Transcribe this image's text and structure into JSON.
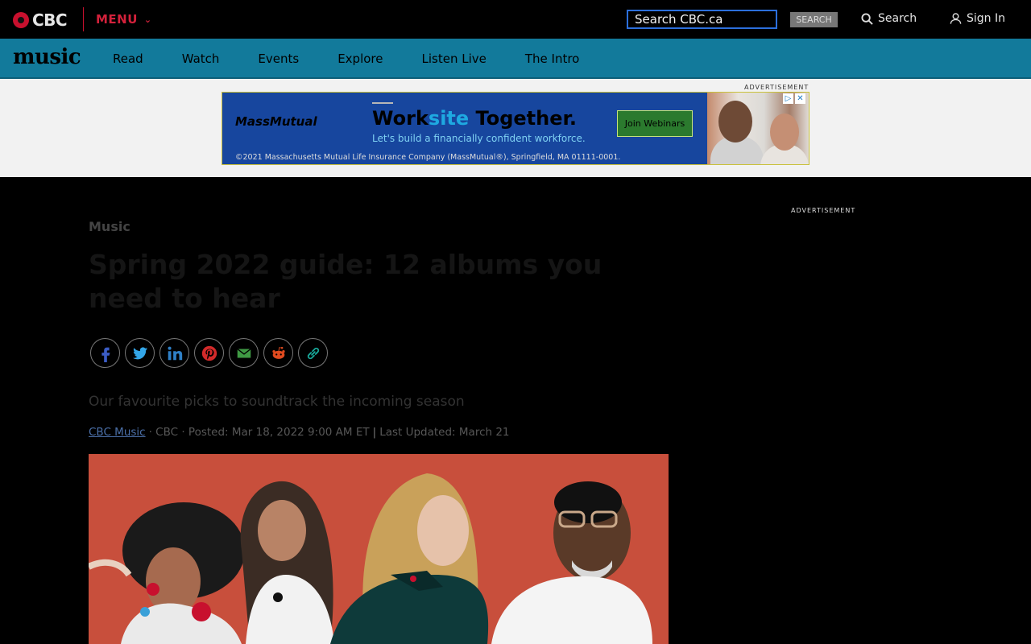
{
  "topbar": {
    "logo_text": "CBC",
    "menu_label": "MENU",
    "search_value": "Search CBC.ca",
    "search_button": "SEARCH",
    "search_link": "Search",
    "signin": "Sign In"
  },
  "nav": {
    "section_logo": "music",
    "items": [
      "Read",
      "Watch",
      "Events",
      "Explore",
      "Listen Live",
      "The Intro"
    ]
  },
  "ad": {
    "label": "ADVERTISEMENT",
    "brand": "MassMutual",
    "headline_a": "Work",
    "headline_b": "site",
    "headline_c": " Together.",
    "sub": "Let's build a financially confident workforce.",
    "cta": "Join Webinars",
    "legal": "©2021 Massachusetts Mutual Life Insurance Company (MassMutual®), Springfield, MA 01111-0001."
  },
  "sidebar": {
    "ad_label": "ADVERTISEMENT"
  },
  "article": {
    "kicker": "Music",
    "headline": "Spring 2022 guide: 12 albums you need to hear",
    "deck": "Our favourite picks to soundtrack the incoming season",
    "author": "CBC Music",
    "source": "· CBC · Posted: Mar 18, 2022 9:00 AM ET",
    "updated": "Last Updated: March 21"
  },
  "share_icons": [
    "facebook-icon",
    "twitter-icon",
    "linkedin-icon",
    "pinterest-icon",
    "email-icon",
    "reddit-icon",
    "link-icon"
  ],
  "colors": {
    "nav_bg": "#127a9b",
    "brand_red": "#c8102e",
    "hero_bg": "#c84f3c",
    "ad_bg": "#17469e"
  }
}
